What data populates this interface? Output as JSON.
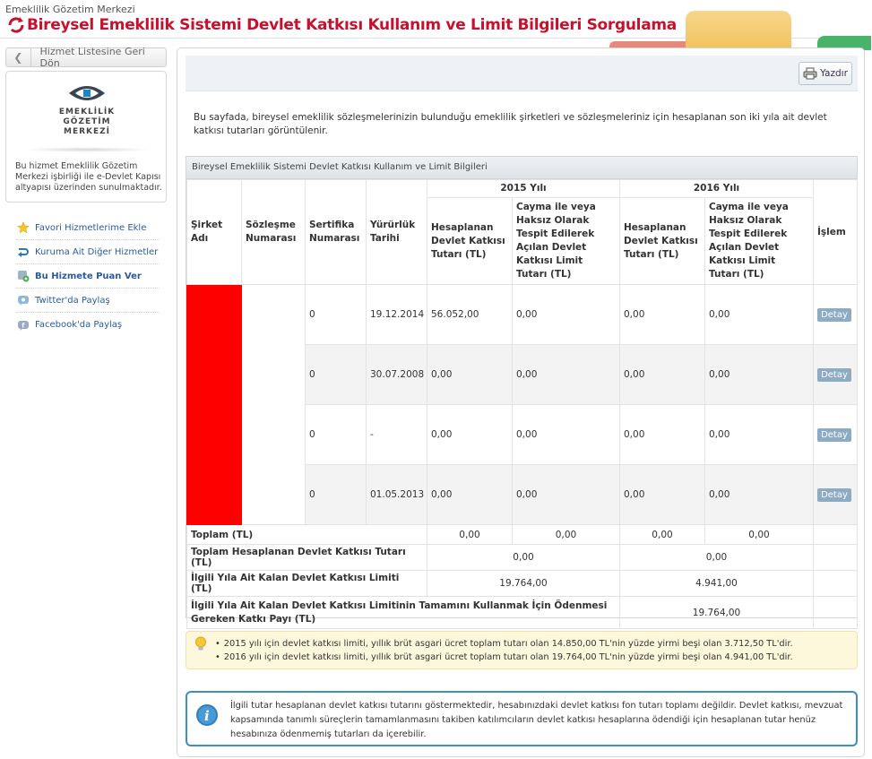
{
  "header": {
    "org": "Emeklilik Gözetim Merkezi",
    "title": "Bireysel Emeklilik Sistemi Devlet Katkısı Kullanım ve Limit Bilgileri Sorgulama"
  },
  "sidebar": {
    "back_label": "Hizmet Listesine Geri Dön",
    "institution_name": [
      "EMEKLİLİK",
      "GÖZETİM",
      "MERKEZİ"
    ],
    "institution_desc": "Bu hizmet Emeklilik Gözetim Merkezi işbirliği ile e-Devlet Kapısı altyapısı üzerinden sunulmaktadır.",
    "links": [
      {
        "label": "Favori Hizmetlerime Ekle",
        "icon": "star-icon"
      },
      {
        "label": "Kuruma Ait Diğer Hizmetler",
        "icon": "arrow-return-icon"
      },
      {
        "label": "Bu Hizmete Puan Ver",
        "icon": "rate-icon"
      },
      {
        "label": "Twitter'da Paylaş",
        "icon": "twitter-icon"
      },
      {
        "label": "Facebook'da Paylaş",
        "icon": "facebook-icon"
      }
    ]
  },
  "toolbar": {
    "print_label": "Yazdır"
  },
  "intro": "Bu sayfada, bireysel emeklilik sözleşmelerinizin bulunduğu emeklilik şirketleri ve sözleşmeleriniz için hesaplanan son iki yıla ait devlet katkısı tutarları görüntülenir.",
  "panel_title": "Bireysel Emeklilik Sistemi Devlet Katkısı Kullanım ve Limit Bilgileri",
  "table": {
    "headers": {
      "company": "Şirket Adı",
      "contract": "Sözleşme Numarası",
      "certificate": "Sertifika Numarası",
      "effective_date": "Yürürlük Tarihi",
      "year1": "2015 Yılı",
      "year2": "2016 Yılı",
      "calc": "Hesaplanan Devlet Katkısı Tutarı (TL)",
      "limit": "Cayma ile veya Haksız Olarak Tespit Edilerek Açılan Devlet Katkısı Limit Tutarı (TL)",
      "action": "İşlem"
    },
    "rows": [
      {
        "cert": "0",
        "date": "19.12.2014",
        "y1_calc": "56.052,00",
        "y1_limit": "0,00",
        "y2_calc": "0,00",
        "y2_limit": "0,00",
        "action": "Detay"
      },
      {
        "cert": "0",
        "date": "30.07.2008",
        "y1_calc": "0,00",
        "y1_limit": "0,00",
        "y2_calc": "0,00",
        "y2_limit": "0,00",
        "action": "Detay"
      },
      {
        "cert": "0",
        "date": "-",
        "y1_calc": "0,00",
        "y1_limit": "0,00",
        "y2_calc": "0,00",
        "y2_limit": "0,00",
        "action": "Detay"
      },
      {
        "cert": "0",
        "date": "01.05.2013",
        "y1_calc": "0,00",
        "y1_limit": "0,00",
        "y2_calc": "0,00",
        "y2_limit": "0,00",
        "action": "Detay"
      }
    ],
    "footer": {
      "total_label": "Toplam (TL)",
      "total_vals": [
        "0,00",
        "0,00",
        "0,00",
        "0,00"
      ],
      "total_calc_label": "Toplam Hesaplanan Devlet Katkısı Tutarı (TL)",
      "total_calc_vals": [
        "0,00",
        "0,00"
      ],
      "remaining_label": "İlgili Yıla Ait Kalan Devlet Katkısı Limiti (TL)",
      "remaining_vals": [
        "19.764,00",
        "4.941,00"
      ],
      "required_label": "İlgili Yıla Ait Kalan Devlet Katkısı Limitinin Tamamını Kullanmak İçin Ödenmesi Gereken Katkı Payı (TL)",
      "required_val": "19.764,00"
    }
  },
  "notes": [
    "2015 yılı için devlet katkısı limiti, yıllık brüt asgari ücret toplam tutarı olan 14.850,00 TL'nin yüzde yirmi beşi olan 3.712,50 TL'dir.",
    "2016 yılı için devlet katkısı limiti, yıllık brüt asgari ücret toplam tutarı olan 19.764,00 TL'nin yüzde yirmi beşi olan 4.941,00 TL'dir."
  ],
  "info": "İlgili tutar hesaplanan devlet katkısı tutarını göstermektedir, hesabınızdaki devlet katkısı fon tutarı toplamı değildir. Devlet katkısı, mevzuat kapsamında tanımlı süreçlerin tamamlanmasını takiben katılımcıların devlet katkısı hesaplarına ödendiği için hesaplanan tutar henüz hesabınıza ödenmemiş tutarları da içerebilir.",
  "colors": {
    "brand_red": "#c8102e",
    "redacted": "#ff0000",
    "button_blue": "#8eabc4",
    "info_border": "#3d8fc0"
  }
}
